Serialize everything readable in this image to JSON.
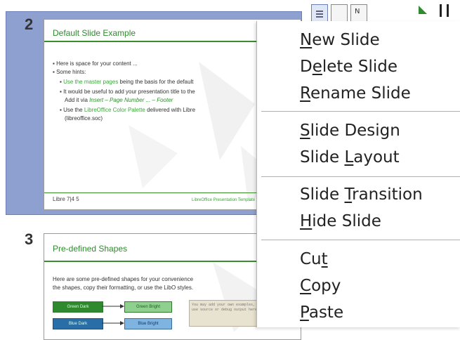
{
  "slides": [
    {
      "number": "2",
      "title": "Default Slide Example",
      "bullets": [
        {
          "text": "Here is space for your content ..."
        },
        {
          "text": "Some hints:"
        },
        {
          "pre": "",
          "accent": "Use the master pages",
          "post": " being the basis for the default"
        },
        {
          "pre": "It would be useful to add your presentation title to the",
          "accent": "",
          "post": ""
        },
        {
          "pre": "Add it via ",
          "accent": "Insert – Page Number ... – Footer",
          "post": ""
        },
        {
          "pre": "Use the ",
          "accent": "LibreOffice Color Palette",
          "post": " delivered with Libre"
        },
        {
          "pre": "(libreoffice.soc)",
          "accent": "",
          "post": ""
        }
      ],
      "logo": "Libre 7|4 5",
      "footer": "LibreOffice Presentation Template"
    },
    {
      "number": "3",
      "title": "Pre-defined Shapes",
      "body1": "Here are some pre-defined shapes for your convenience",
      "body2": "the shapes, copy their formatting, or use the LibO styles.",
      "shapes": [
        "Green Dark",
        "Green Bright",
        "Blue Dark",
        "Blue Bright"
      ],
      "note": "You may add your own examples, use source or debug output here"
    }
  ],
  "context_menu": {
    "items": [
      {
        "pre": "",
        "key": "N",
        "post": "ew Slide"
      },
      {
        "pre": "D",
        "key": "e",
        "post": "lete Slide"
      },
      {
        "pre": "",
        "key": "R",
        "post": "ename Slide"
      },
      {
        "pre": "",
        "key": "S",
        "post": "lide Design"
      },
      {
        "pre": "Slide ",
        "key": "L",
        "post": "ayout"
      },
      {
        "pre": "Slide ",
        "key": "T",
        "post": "ransition"
      },
      {
        "pre": "",
        "key": "H",
        "post": "ide Slide"
      },
      {
        "pre": "Cu",
        "key": "t",
        "post": ""
      },
      {
        "pre": "",
        "key": "C",
        "post": "opy"
      },
      {
        "pre": "",
        "key": "P",
        "post": "aste"
      }
    ]
  },
  "colors": {
    "accent": "#3aa63a",
    "selection": "#8ea0cf"
  }
}
